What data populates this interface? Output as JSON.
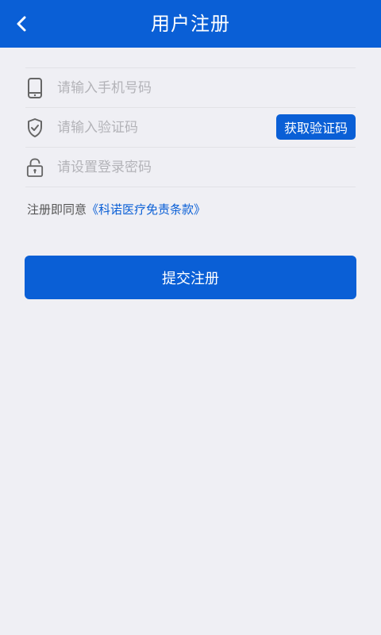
{
  "header": {
    "title": "用户注册",
    "back_icon": "chevron-left-icon"
  },
  "form": {
    "phone": {
      "icon": "phone-icon",
      "placeholder": "请输入手机号码",
      "value": ""
    },
    "code": {
      "icon": "shield-check-icon",
      "placeholder": "请输入验证码",
      "value": "",
      "button_label": "获取验证码"
    },
    "password": {
      "icon": "unlock-icon",
      "placeholder": "请设置登录密码",
      "value": ""
    }
  },
  "agreement": {
    "prefix": "注册即同意",
    "link": "《科诺医疗免责条款》"
  },
  "submit_label": "提交注册",
  "colors": {
    "primary": "#0a5fd6",
    "background": "#efeff4",
    "placeholder": "#b3b3b8"
  }
}
